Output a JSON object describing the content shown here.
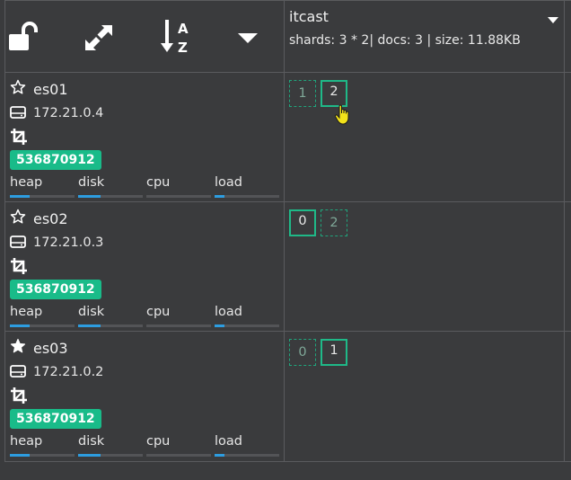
{
  "header": {
    "icons": [
      "unlock-icon",
      "expand-icon",
      "sort-alpha-icon",
      "caret-down-icon"
    ]
  },
  "index": {
    "name": "itcast",
    "stats": "shards: 3 * 2| docs: 3 | size: 11.88KB"
  },
  "nodes": [
    {
      "name": "es01",
      "ip": "172.21.0.4",
      "badge": "536870912",
      "master": false,
      "metrics": [
        {
          "label": "heap",
          "fill": 0.3
        },
        {
          "label": "disk",
          "fill": 0.35
        },
        {
          "label": "cpu",
          "fill": 0.0
        },
        {
          "label": "load",
          "fill": 0.15
        }
      ],
      "shards": [
        {
          "label": "1",
          "type": "replica"
        },
        {
          "label": "2",
          "type": "primary"
        }
      ]
    },
    {
      "name": "es02",
      "ip": "172.21.0.3",
      "badge": "536870912",
      "master": false,
      "metrics": [
        {
          "label": "heap",
          "fill": 0.3
        },
        {
          "label": "disk",
          "fill": 0.35
        },
        {
          "label": "cpu",
          "fill": 0.0
        },
        {
          "label": "load",
          "fill": 0.15
        }
      ],
      "shards": [
        {
          "label": "0",
          "type": "primary"
        },
        {
          "label": "2",
          "type": "replica"
        }
      ]
    },
    {
      "name": "es03",
      "ip": "172.21.0.2",
      "badge": "536870912",
      "master": true,
      "metrics": [
        {
          "label": "heap",
          "fill": 0.3
        },
        {
          "label": "disk",
          "fill": 0.35
        },
        {
          "label": "cpu",
          "fill": 0.0
        },
        {
          "label": "load",
          "fill": 0.15
        }
      ],
      "shards": [
        {
          "label": "0",
          "type": "replica"
        },
        {
          "label": "1",
          "type": "primary"
        }
      ]
    }
  ],
  "colors": {
    "background": "#3a3b3d",
    "gridline": "#5a5b5e",
    "badge": "#19bb89",
    "shard_border": "#1fb988",
    "metric_fill": "#2d9de0"
  }
}
